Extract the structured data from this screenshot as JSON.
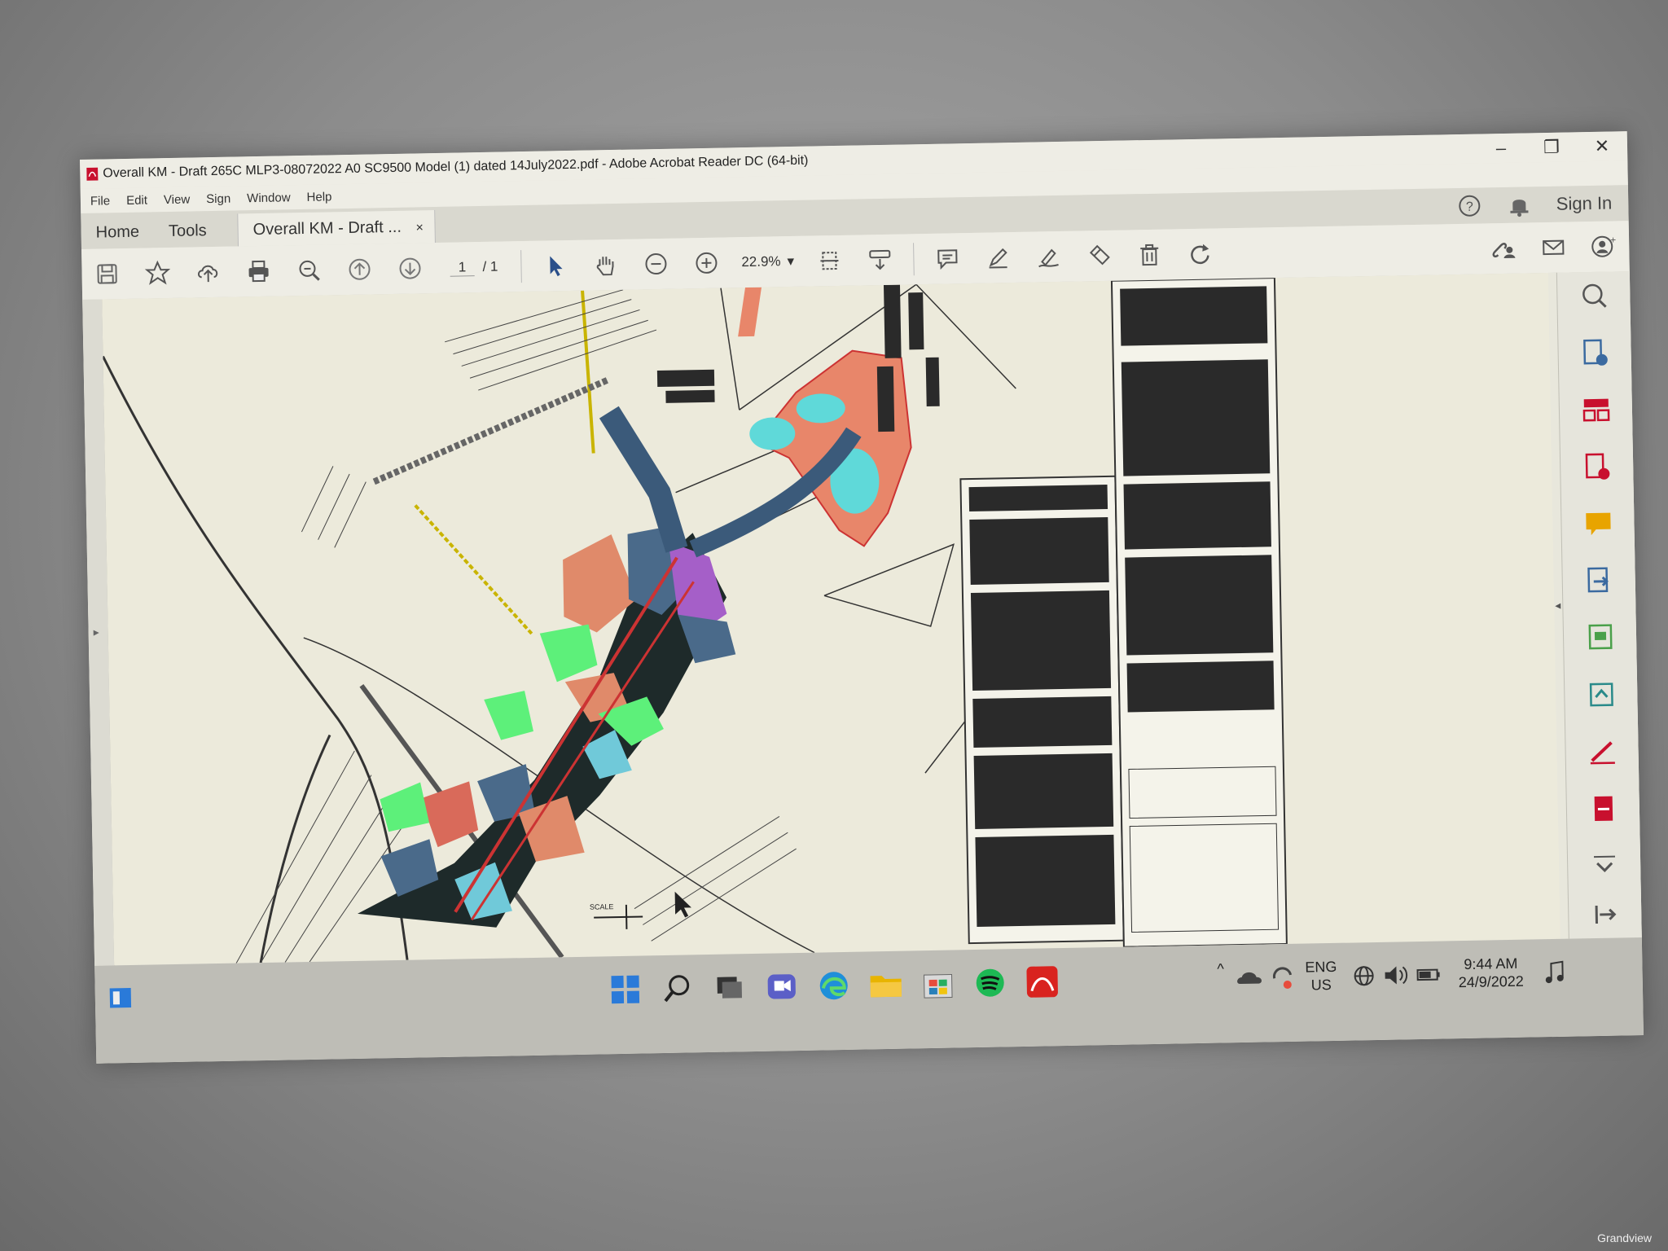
{
  "window": {
    "title": "Overall KM - Draft 265C MLP3-08072022 A0 SC9500 Model (1) dated 14July2022.pdf - Adobe Acrobat Reader DC (64-bit)"
  },
  "menu": [
    "File",
    "Edit",
    "View",
    "Sign",
    "Window",
    "Help"
  ],
  "tabs": {
    "home": "Home",
    "tools": "Tools",
    "document": "Overall KM - Draft ...",
    "close": "×"
  },
  "header_right": {
    "sign_in": "Sign In"
  },
  "toolbar": {
    "page_current": "1",
    "page_total": "/ 1",
    "zoom": "22.9%"
  },
  "plan_labels": {
    "scale_note": "SCALE"
  },
  "tray": {
    "lang_top": "ENG",
    "lang_bottom": "US",
    "time": "9:44 AM",
    "date": "24/9/2022"
  },
  "projector_brand": "Grandview"
}
